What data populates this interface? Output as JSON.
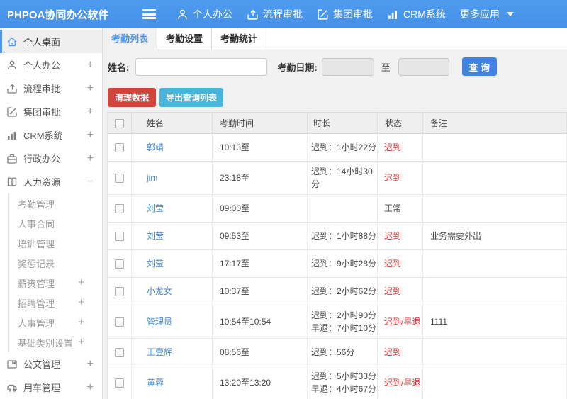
{
  "topbar": {
    "logo": "PHPOA协同办公软件",
    "nav": [
      {
        "label": "个人办公",
        "icon": "user-icon"
      },
      {
        "label": "流程审批",
        "icon": "workflow-icon"
      },
      {
        "label": "集团审批",
        "icon": "edit-icon"
      },
      {
        "label": "CRM系统",
        "icon": "chart-icon"
      },
      {
        "label": "更多应用",
        "icon": "",
        "caret": true
      }
    ]
  },
  "sidebar": {
    "items": [
      {
        "label": "个人桌面",
        "icon": "home-icon",
        "active": true
      },
      {
        "label": "个人办公",
        "icon": "user-icon",
        "expand": "+"
      },
      {
        "label": "流程审批",
        "icon": "workflow-icon",
        "expand": "+"
      },
      {
        "label": "集团审批",
        "icon": "edit-icon",
        "expand": "+"
      },
      {
        "label": "CRM系统",
        "icon": "chart-icon",
        "expand": "+"
      },
      {
        "label": "行政办公",
        "icon": "briefcase-icon",
        "expand": "+"
      },
      {
        "label": "人力资源",
        "icon": "book-icon",
        "expand": "−",
        "expanded": true,
        "children": [
          {
            "label": "考勤管理"
          },
          {
            "label": "人事合同"
          },
          {
            "label": "培训管理"
          },
          {
            "label": "奖惩记录"
          },
          {
            "label": "薪资管理",
            "expand": "+"
          },
          {
            "label": "招聘管理",
            "expand": "+"
          },
          {
            "label": "人事管理",
            "expand": "+"
          },
          {
            "label": "基础类别设置",
            "expand": "+"
          }
        ]
      },
      {
        "label": "公文管理",
        "icon": "doc-icon",
        "expand": "+"
      },
      {
        "label": "用车管理",
        "icon": "car-icon",
        "expand": "+"
      }
    ]
  },
  "tabs": [
    {
      "label": "考勤列表",
      "active": true
    },
    {
      "label": "考勤设置",
      "active": false
    },
    {
      "label": "考勤统计",
      "active": false
    }
  ],
  "filter": {
    "name_label": "姓名:",
    "name_value": "",
    "date_label": "考勤日期:",
    "date_from_value": "",
    "to_label": "至",
    "date_to_value": "",
    "search_button": "查 询"
  },
  "actions": {
    "clear_button": "清理数据",
    "export_button": "导出查询列表"
  },
  "table": {
    "headers": [
      "姓名",
      "考勤时间",
      "时长",
      "状态",
      "备注"
    ],
    "rows": [
      {
        "name": "郭靖",
        "time": "10:13至",
        "duration": [
          "迟到：1小时22分"
        ],
        "status": "迟到",
        "status_type": "late",
        "remark": ""
      },
      {
        "name": "jim",
        "time": "23:18至",
        "duration": [
          "迟到：14小时30分"
        ],
        "status": "迟到",
        "status_type": "late",
        "remark": ""
      },
      {
        "name": "刘莹",
        "time": "09:00至",
        "duration": [],
        "status": "正常",
        "status_type": "normal",
        "remark": ""
      },
      {
        "name": "刘莹",
        "time": "09:53至",
        "duration": [
          "迟到：1小时88分"
        ],
        "status": "迟到",
        "status_type": "late",
        "remark": "业务需要外出"
      },
      {
        "name": "刘莹",
        "time": "17:17至",
        "duration": [
          "迟到：9小时28分"
        ],
        "status": "迟到",
        "status_type": "late",
        "remark": ""
      },
      {
        "name": "小龙女",
        "time": "10:37至",
        "duration": [
          "迟到：2小时62分"
        ],
        "status": "迟到",
        "status_type": "late",
        "remark": ""
      },
      {
        "name": "管理员",
        "time": "10:54至10:54",
        "duration": [
          "迟到：2小时90分",
          "早退：7小时10分"
        ],
        "status": "迟到/早退",
        "status_type": "late",
        "remark": "1111"
      },
      {
        "name": "王壹辉",
        "time": "08:56至",
        "duration": [
          "迟到：56分"
        ],
        "status": "迟到",
        "status_type": "late",
        "remark": ""
      },
      {
        "name": "黄蓉",
        "time": "13:20至13:20",
        "duration": [
          "迟到：5小时33分",
          "早退：4小时67分"
        ],
        "status": "迟到/早退",
        "status_type": "late",
        "remark": ""
      }
    ]
  },
  "colors": {
    "topbar_blue": "#4A96EC",
    "accent_blue": "#4A96EC",
    "link_blue": "#4288CE",
    "status_red": "#CC3333",
    "danger_red": "#D2453C",
    "info_cyan": "#47B5DB",
    "search_blue": "#4282E2"
  }
}
